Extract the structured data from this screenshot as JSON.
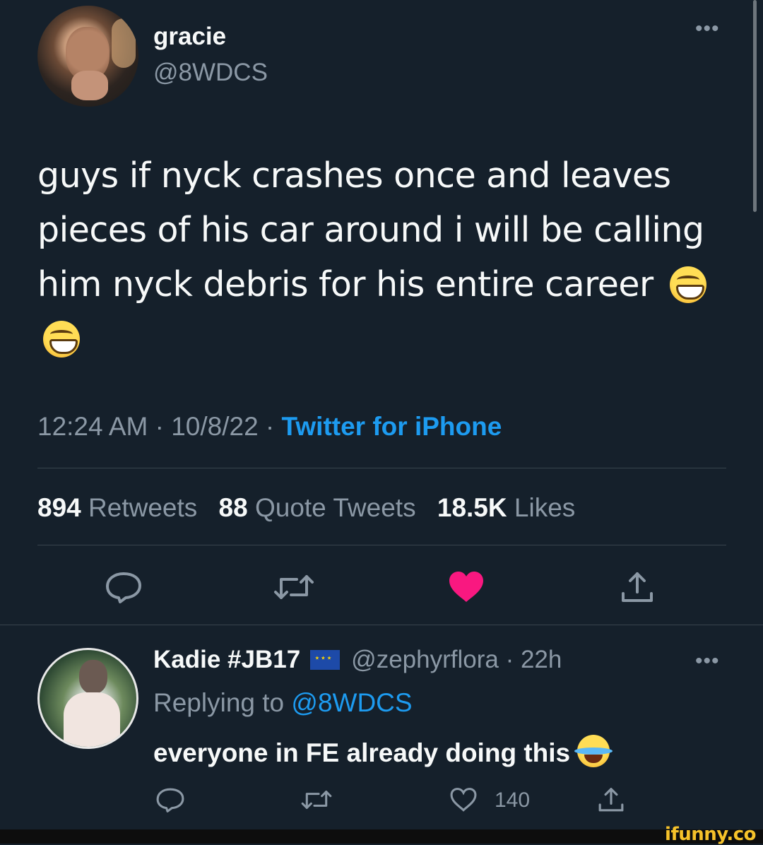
{
  "main_tweet": {
    "name": "gracie",
    "handle": "@8WDCS",
    "text": "guys if nyck crashes once and leaves pieces of his car around i will be calling him nyck debris for his entire career",
    "emojis": [
      "grinning-face-with-smiling-eyes",
      "grinning-face-with-smiling-eyes"
    ],
    "meta": "12:24 AM · 10/8/22 · ",
    "source": "Twitter for iPhone",
    "stats": {
      "retweets_count": "894",
      "retweets_label": "Retweets",
      "quotes_count": "88",
      "quotes_label": "Quote Tweets",
      "likes_count": "18.5K",
      "likes_label": "Likes"
    },
    "actions": {
      "reply_icon": "reply-icon",
      "retweet_icon": "retweet-icon",
      "like_icon": "heart-filled-icon",
      "share_icon": "share-icon"
    }
  },
  "reply_tweet": {
    "name": "Kadie #JB17",
    "flag": "eu-flag",
    "handle": "@zephyrflora",
    "time": "· 22h",
    "replying_label": "Replying to ",
    "replying_mention": "@8WDCS",
    "text": "everyone in FE already doing this",
    "emoji": "face-with-tears-of-joy",
    "like_count": "140"
  },
  "colors": {
    "background": "#15202b",
    "text": "#f7f9f9",
    "secondary": "#8b98a5",
    "accent": "#1d9bf0",
    "like": "#f91880"
  },
  "watermark": "ifunny.co"
}
